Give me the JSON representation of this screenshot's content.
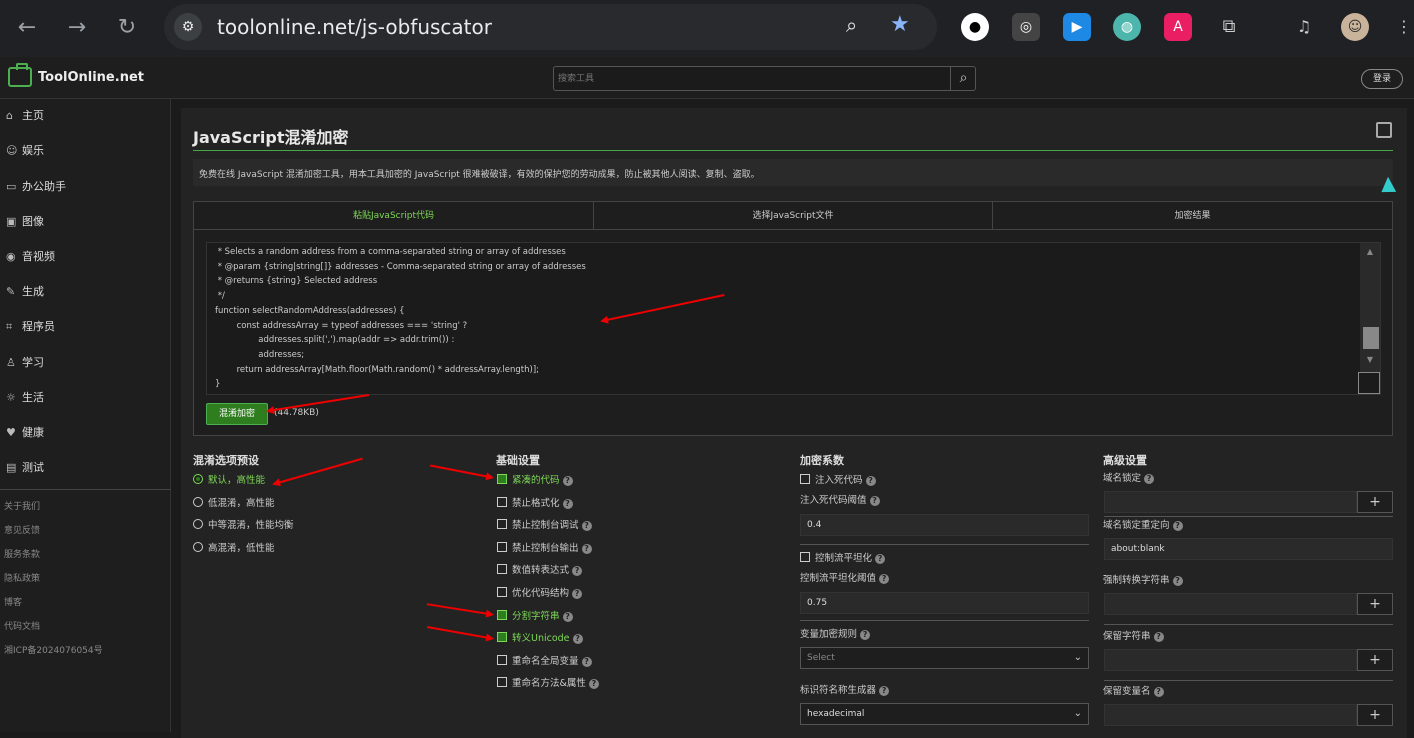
{
  "browser": {
    "url": "toolonline.net/js-obfuscator"
  },
  "header": {
    "logo": "ToolOnline.net",
    "search_placeholder": "搜索工具",
    "login": "登录"
  },
  "sidebar": {
    "items": [
      {
        "label": "主页",
        "icon": "⌂"
      },
      {
        "label": "娱乐",
        "icon": "☺"
      },
      {
        "label": "办公助手",
        "icon": "▭"
      },
      {
        "label": "图像",
        "icon": "▣"
      },
      {
        "label": "音视频",
        "icon": "◉"
      },
      {
        "label": "生成",
        "icon": "✎"
      },
      {
        "label": "程序员",
        "icon": "⌗"
      },
      {
        "label": "学习",
        "icon": "♙"
      },
      {
        "label": "生活",
        "icon": "☼"
      },
      {
        "label": "健康",
        "icon": "♥"
      },
      {
        "label": "测试",
        "icon": "▤"
      }
    ],
    "links": [
      "关于我们",
      "意见反馈",
      "服务条款",
      "隐私政策",
      "博客",
      "代码文档",
      "湘ICP备2024076054号"
    ]
  },
  "page": {
    "title": "JavaScript混淆加密",
    "description": "免费在线 JavaScript 混淆加密工具，用本工具加密的 JavaScript 很难被破译，有效的保护您的劳动成果，防止被其他人阅读、复制、盗取。"
  },
  "tabs": [
    {
      "label": "粘贴JavaScript代码"
    },
    {
      "label": "选择JavaScript文件"
    },
    {
      "label": "加密结果"
    }
  ],
  "code_lines": [
    " * Selects a random address from a comma-separated string or array of addresses",
    " * @param {string|string[]} addresses - Comma-separated string or array of addresses",
    " * @returns {string} Selected address",
    " */",
    "function selectRandomAddress(addresses) {",
    "        const addressArray = typeof addresses === 'string' ?",
    "                addresses.split(',').map(addr => addr.trim()) :",
    "                addresses;",
    "        return addressArray[Math.floor(Math.random() * addressArray.length)];",
    "}"
  ],
  "obfuscate_button": "混淆加密",
  "file_size": "(44.78KB)",
  "presets": {
    "title": "混淆选项预设",
    "options": [
      {
        "label": "默认，高性能",
        "checked": true
      },
      {
        "label": "低混淆，高性能",
        "checked": false
      },
      {
        "label": "中等混淆，性能均衡",
        "checked": false
      },
      {
        "label": "高混淆，低性能",
        "checked": false
      }
    ]
  },
  "basic": {
    "title": "基础设置",
    "options": [
      {
        "label": "紧凑的代码",
        "checked": true
      },
      {
        "label": "禁止格式化",
        "checked": false
      },
      {
        "label": "禁止控制台调试",
        "checked": false
      },
      {
        "label": "禁止控制台输出",
        "checked": false
      },
      {
        "label": "数值转表达式",
        "checked": false
      },
      {
        "label": "优化代码结构",
        "checked": false
      },
      {
        "label": "分割字符串",
        "checked": true
      },
      {
        "label": "转义Unicode",
        "checked": true
      },
      {
        "label": "重命名全局变量",
        "checked": false
      },
      {
        "label": "重命名方法&属性",
        "checked": false
      }
    ]
  },
  "encryption": {
    "title": "加密系数",
    "dead_code_label": "注入死代码",
    "dead_code_threshold_label": "注入死代码阈值",
    "dead_code_threshold": "0.4",
    "control_flow_label": "控制流平坦化",
    "control_flow_threshold_label": "控制流平坦化阈值",
    "control_flow_threshold": "0.75",
    "var_rule_label": "变量加密规则",
    "var_rule_value": "Select",
    "id_gen_label": "标识符名称生成器",
    "id_gen_value": "hexadecimal"
  },
  "advanced": {
    "title": "高级设置",
    "domain_lock_label": "域名锁定",
    "domain_redirect_label": "域名锁定重定向",
    "domain_redirect_value": "about:blank",
    "force_string_label": "强制转换字符串",
    "reserved_strings_label": "保留字符串",
    "reserved_names_label": "保留变量名"
  },
  "colors": {
    "accent": "#7ed957",
    "button": "#2e7d1e",
    "annotation": "#e00000"
  }
}
